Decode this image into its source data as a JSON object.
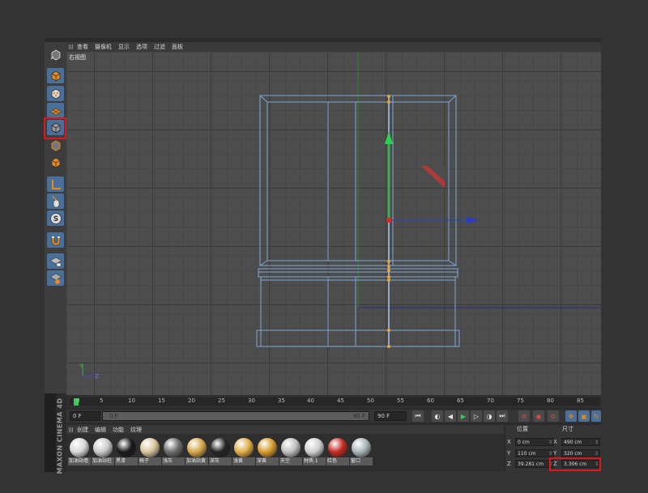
{
  "app": {
    "brand": "MAXON CINEMA 4D",
    "accent": "#4a6f98",
    "highlight_color": "#e0161d"
  },
  "left_toolbar": [
    {
      "icon": "model-mode-icon"
    },
    {
      "icon": "texture-mode-icon"
    },
    {
      "icon": "workplane-icon"
    },
    {
      "icon": "points-mode-icon"
    },
    {
      "icon": "edges-mode-icon"
    },
    {
      "icon": "polygons-mode-icon"
    },
    {
      "icon": "enable-axis-icon"
    },
    {
      "icon": "tweak-icon"
    },
    {
      "icon": "snap-icon"
    },
    {
      "icon": "magnet-icon"
    },
    {
      "icon": "lock-workplane-icon"
    },
    {
      "icon": "planar-workplane-icon"
    }
  ],
  "viewport": {
    "menu": [
      "查看",
      "摄像机",
      "显示",
      "选项",
      "过滤",
      "面板"
    ],
    "title": "右视图",
    "axis_labels": {
      "y": "Y",
      "z": "Z"
    }
  },
  "timeline": {
    "ticks": [
      "0",
      "5",
      "10",
      "15",
      "20",
      "25",
      "30",
      "35",
      "40",
      "45",
      "50",
      "55",
      "60",
      "65",
      "70",
      "75",
      "80",
      "85"
    ]
  },
  "transport": {
    "current_frame": "0 F",
    "range_start": "0 F",
    "range_end": "90 F",
    "end_frame": "90 F"
  },
  "material_manager": {
    "menu": [
      "创建",
      "编辑",
      "功能",
      "纹理"
    ],
    "materials": [
      {
        "name": "加油站墙",
        "color": "#d8d8d8"
      },
      {
        "name": "加油站柱",
        "color": "#c9c9c9"
      },
      {
        "name": "黑漆",
        "color": "#1a1a1a"
      },
      {
        "name": "椅子",
        "color": "#d8c49a"
      },
      {
        "name": "浅灰",
        "color": "#6d6d6d"
      },
      {
        "name": "加油站黄",
        "color": "#d6a84a"
      },
      {
        "name": "深灰",
        "color": "#252525"
      },
      {
        "name": "浅黄",
        "color": "#e0ae48"
      },
      {
        "name": "深黄",
        "color": "#d89a2e"
      },
      {
        "name": "天空",
        "color": "#bfbfbf"
      },
      {
        "name": "材质.1",
        "color": "#cfcfcf"
      },
      {
        "name": "红色",
        "color": "#c42b22"
      },
      {
        "name": "窗口",
        "color": "#a9b4b8"
      }
    ]
  },
  "coordinates": {
    "position_header": "位置",
    "size_header": "尺寸",
    "position": [
      {
        "axis": "X",
        "value": "0 cm"
      },
      {
        "axis": "Y",
        "value": "110 cm"
      },
      {
        "axis": "Z",
        "value": "39.281 cm"
      }
    ],
    "size": [
      {
        "axis": "X",
        "value": "490 cm"
      },
      {
        "axis": "Y",
        "value": "320 cm"
      },
      {
        "axis": "Z",
        "value": "3.306 cm"
      }
    ]
  }
}
